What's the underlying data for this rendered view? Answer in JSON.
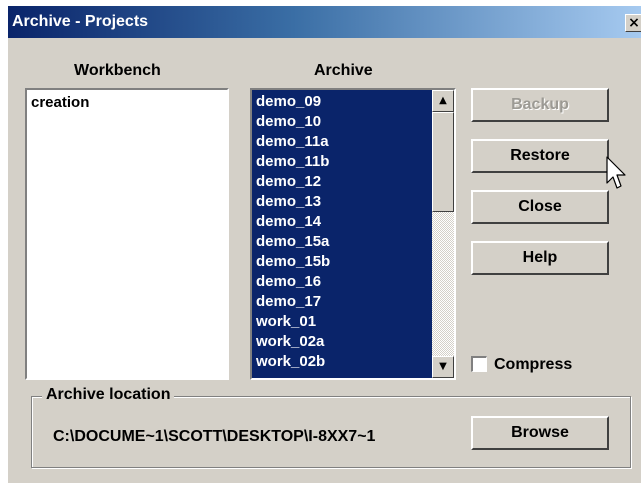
{
  "window": {
    "title": "Archive - Projects",
    "close_label": "×"
  },
  "workbench": {
    "header": "Workbench",
    "items": [
      "creation"
    ]
  },
  "archive": {
    "header": "Archive",
    "items": [
      "demo_09",
      "demo_10",
      "demo_11a",
      "demo_11b",
      "demo_12",
      "demo_13",
      "demo_14",
      "demo_15a",
      "demo_15b",
      "demo_16",
      "demo_17",
      "work_01",
      "work_02a",
      "work_02b"
    ],
    "selected_color": "#0a246a"
  },
  "buttons": {
    "backup": "Backup",
    "restore": "Restore",
    "close": "Close",
    "help": "Help",
    "browse": "Browse"
  },
  "compress": {
    "label": "Compress",
    "checked": false
  },
  "location": {
    "legend": "Archive location",
    "path": "C:\\DOCUME~1\\SCOTT\\DESKTOP\\I-8XX7~1"
  },
  "scrollbar": {
    "up_icon": "▲",
    "down_icon": "▼"
  }
}
